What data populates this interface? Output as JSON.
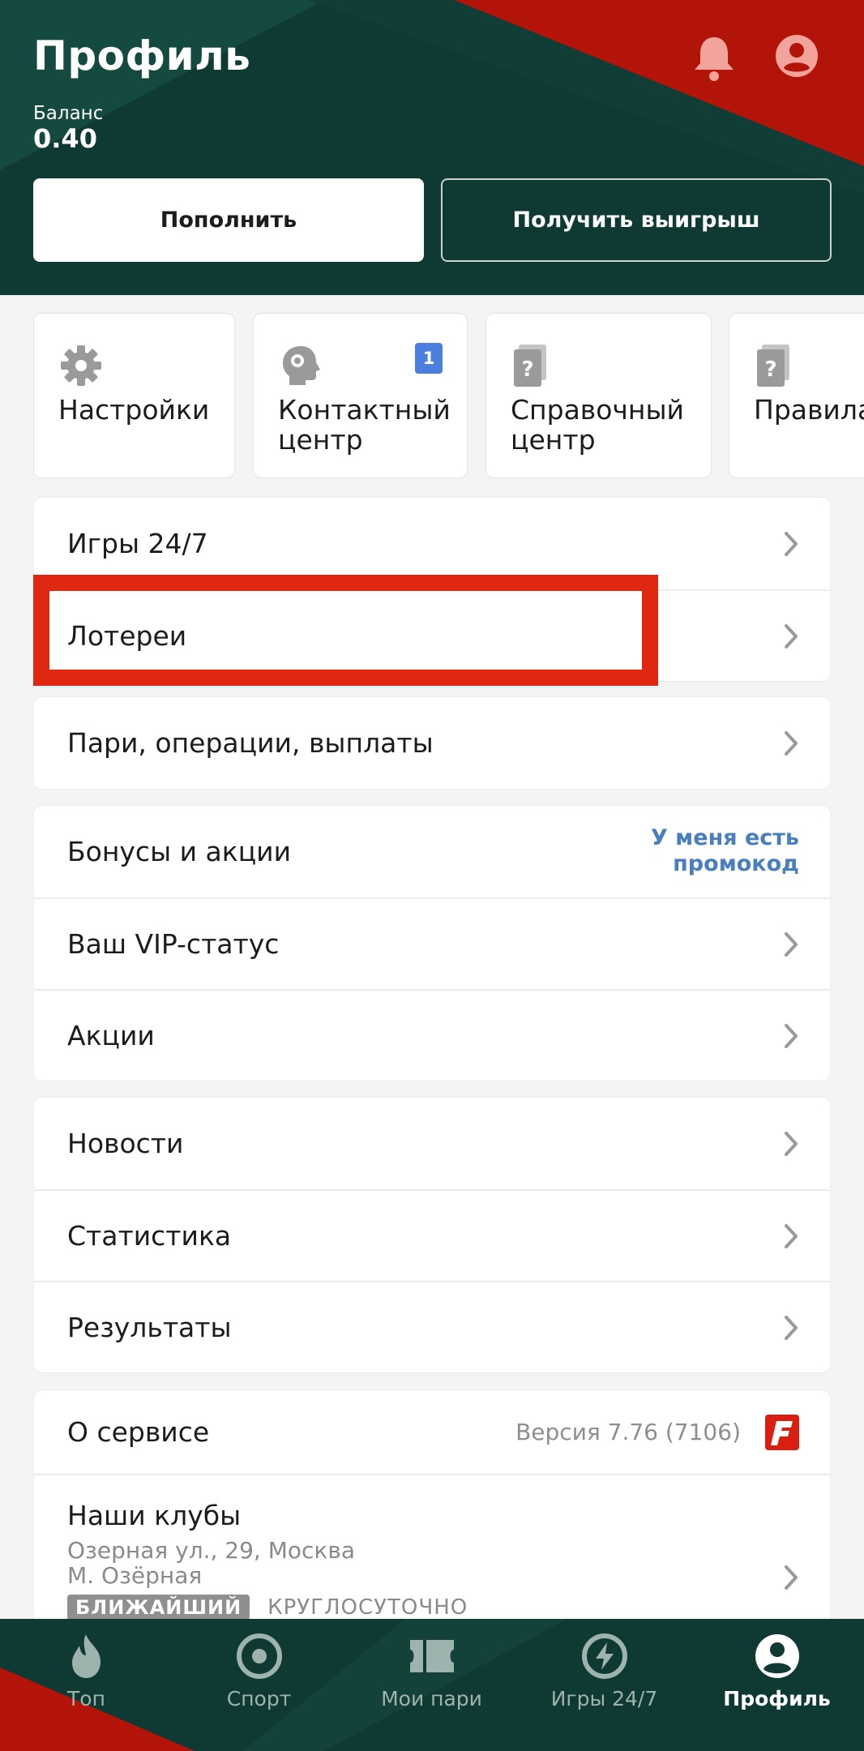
{
  "header": {
    "title": "Профиль",
    "balance_label": "Баланс",
    "balance_value": "0.40",
    "deposit_label": "Пополнить",
    "withdraw_label": "Получить выигрыш"
  },
  "quick_tiles": [
    {
      "label": "Настройки",
      "icon": "gear-icon"
    },
    {
      "label": "Контактный\nцентр",
      "icon": "support-head-icon",
      "badge": "1"
    },
    {
      "label": "Справочный\nцентр",
      "icon": "help-book-icon"
    },
    {
      "label": "Правила",
      "icon": "rules-book-icon"
    }
  ],
  "menu": {
    "games": "Игры 24/7",
    "lotteries": "Лотереи",
    "bets": "Пари, операции, выплаты",
    "bonuses": "Бонусы и акции",
    "promo_link": "У меня есть\nпромокод",
    "vip": "Ваш VIP-статус",
    "promotions": "Акции",
    "news": "Новости",
    "statistics": "Статистика",
    "results": "Результаты",
    "about": "О сервисе",
    "version": "Версия 7.76 (7106)",
    "clubs_title": "Наши клубы",
    "club_address": "Озерная ул., 29, Москва",
    "club_metro": "М. Озёрная",
    "tag_nearest": "БЛИЖАЙШИЙ",
    "tag_hours": "КРУГЛОСУТОЧНО"
  },
  "bottom_nav": [
    {
      "label": "Топ",
      "icon": "flame-icon"
    },
    {
      "label": "Спорт",
      "icon": "target-icon"
    },
    {
      "label": "Мои пари",
      "icon": "ticket-icon"
    },
    {
      "label": "Игры 24/7",
      "icon": "lightning-icon"
    },
    {
      "label": "Профиль",
      "icon": "user-icon",
      "active": true
    }
  ],
  "colors": {
    "header_bg": "#0f3a33",
    "accent_red": "#b31409",
    "highlight": "#e0270f",
    "badge_blue": "#4a7fe0",
    "promo_link": "#4a7fbf"
  }
}
